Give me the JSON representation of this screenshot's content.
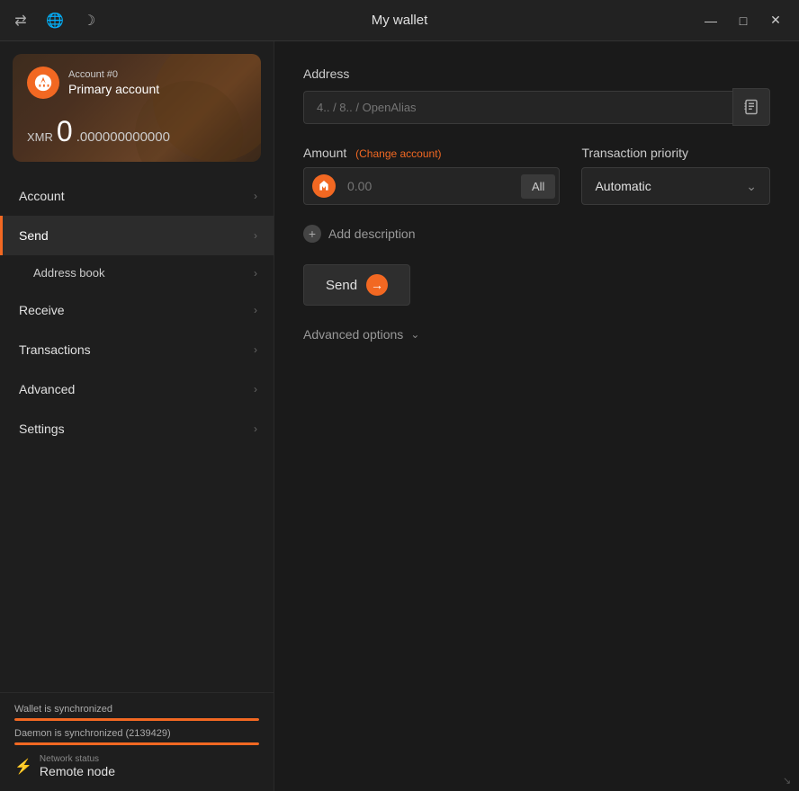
{
  "titlebar": {
    "title": "My wallet",
    "icons": {
      "transfer": "⇄",
      "globe": "🌐",
      "moon": "☽"
    },
    "controls": {
      "minimize": "—",
      "maximize": "□",
      "close": "✕"
    }
  },
  "sidebar": {
    "account_card": {
      "account_number": "Account #0",
      "account_name": "Primary account",
      "balance_currency": "XMR",
      "balance_whole": "0",
      "balance_decimals": ".000000000000"
    },
    "nav_items": [
      {
        "id": "account",
        "label": "Account",
        "active": false
      },
      {
        "id": "send",
        "label": "Send",
        "active": true
      },
      {
        "id": "address-book",
        "label": "Address book",
        "sub": true,
        "active": false
      },
      {
        "id": "receive",
        "label": "Receive",
        "active": false
      },
      {
        "id": "transactions",
        "label": "Transactions",
        "active": false
      },
      {
        "id": "advanced",
        "label": "Advanced",
        "active": false
      },
      {
        "id": "settings",
        "label": "Settings",
        "active": false
      }
    ],
    "footer": {
      "wallet_sync_label": "Wallet is synchronized",
      "daemon_sync_label": "Daemon is synchronized (2139429)",
      "network_label": "Network status",
      "network_value": "Remote node"
    }
  },
  "main": {
    "address_section": {
      "label": "Address",
      "placeholder": "4.. / 8.. / OpenAlias"
    },
    "amount_section": {
      "label": "Amount",
      "change_account": "(Change account)",
      "placeholder": "0.00",
      "all_button": "All"
    },
    "priority_section": {
      "label": "Transaction priority",
      "value": "Automatic"
    },
    "add_description": {
      "label": "Add description"
    },
    "send_button": {
      "label": "Send"
    },
    "advanced_options": {
      "label": "Advanced options"
    }
  }
}
